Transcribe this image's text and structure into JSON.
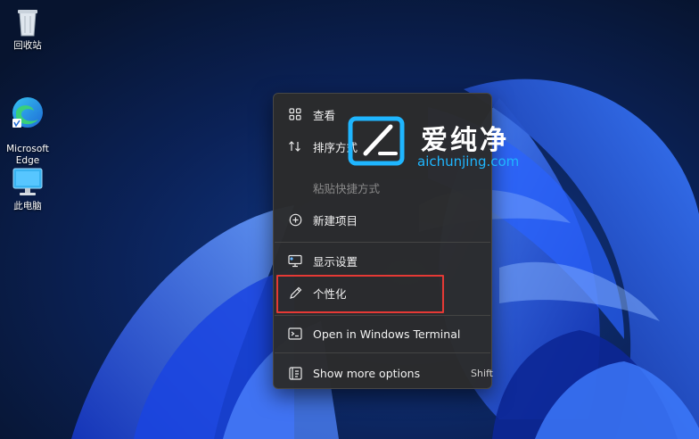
{
  "desktop_icons": [
    {
      "icon": "recycle-bin-icon",
      "label": "回收站"
    },
    {
      "icon": "edge-icon",
      "label": "Microsoft\nEdge"
    },
    {
      "icon": "this-pc-icon",
      "label": "此电脑"
    }
  ],
  "context_menu": {
    "items": [
      {
        "icon": "view-grid-icon",
        "label": "查看",
        "disabled": false
      },
      {
        "icon": "sort-icon",
        "label": "排序方式",
        "disabled": false
      },
      {
        "icon": "",
        "label": "粘贴快捷方式",
        "disabled": true
      },
      {
        "icon": "new-item-icon",
        "label": "新建项目",
        "disabled": false
      },
      {
        "icon": "display-settings-icon",
        "label": "显示设置",
        "disabled": false
      },
      {
        "icon": "personalize-pen-icon",
        "label": "个性化",
        "disabled": false
      },
      {
        "icon": "terminal-icon",
        "label": "Open in Windows Terminal",
        "disabled": false
      },
      {
        "icon": "show-more-icon",
        "label": "Show more options",
        "shortcut": "Shift",
        "disabled": false
      }
    ],
    "highlighted_item": "个性化",
    "highlight_color": "#e53935"
  },
  "watermark": {
    "text_cn": "爱纯净",
    "text_en": "aichunjing.com",
    "accent": "#1fb6ff"
  },
  "colors": {
    "wallpaper_dark": "#0a1a3f",
    "wallpaper_bloom": "#1c4fd8",
    "menu_bg": "#2b2b2b"
  }
}
